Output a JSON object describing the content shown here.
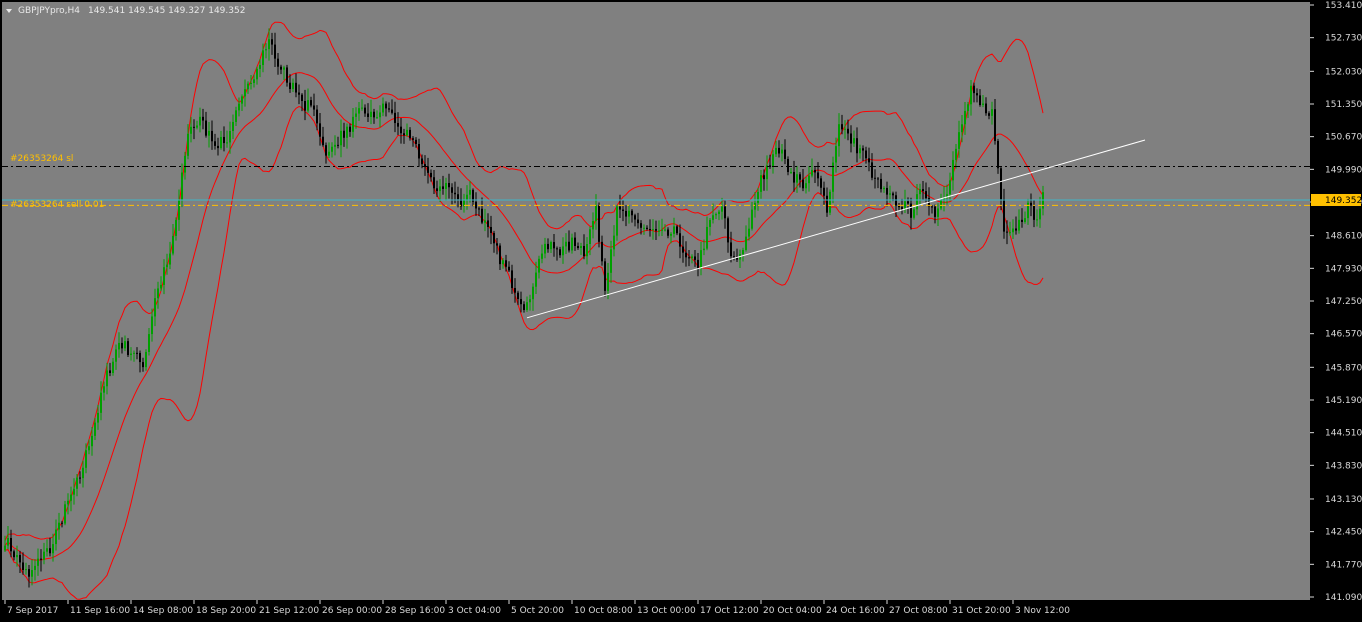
{
  "header": {
    "symbol": "GBPJPYpro,H4",
    "ohlc": "149.541 149.545 149.327 149.352"
  },
  "colors": {
    "background": "#808080",
    "frame": "#000000",
    "bull_candle": "#00a000",
    "bear_candle": "#000000",
    "bollinger": "#ff0000",
    "trendline": "#ffffff",
    "sl_line": "#000000",
    "order_line": "#ffc000",
    "bid_line": "#3fb6c8",
    "price_label_bg": "#ffc000"
  },
  "orders": {
    "sl_label": "#26353264 sl",
    "entry_label": "#26353264 sell 0.01"
  },
  "current_price_label": "149.352",
  "chart_data": {
    "type": "candlestick",
    "timeframe": "H4",
    "y_ticks": [
      "153.410",
      "152.730",
      "152.030",
      "151.350",
      "150.670",
      "149.990",
      "149.310",
      "148.610",
      "147.930",
      "147.250",
      "146.570",
      "145.870",
      "145.190",
      "144.510",
      "143.830",
      "143.130",
      "142.450",
      "141.770",
      "141.090"
    ],
    "ylim": [
      141.09,
      153.41
    ],
    "x_ticks": [
      "7 Sep 2017",
      "11 Sep 16:00",
      "14 Sep 08:00",
      "18 Sep 20:00",
      "21 Sep 12:00",
      "26 Sep 00:00",
      "28 Sep 16:00",
      "3 Oct 04:00",
      "5 Oct 20:00",
      "10 Oct 08:00",
      "13 Oct 00:00",
      "17 Oct 12:00",
      "20 Oct 04:00",
      "24 Oct 16:00",
      "27 Oct 08:00",
      "31 Oct 20:00",
      "3 Nov 12:00"
    ],
    "anchors": [
      [
        0,
        142.3
      ],
      [
        8,
        141.5
      ],
      [
        12,
        141.9
      ],
      [
        16,
        142.2
      ],
      [
        20,
        142.9
      ],
      [
        25,
        143.6
      ],
      [
        29,
        144.5
      ],
      [
        34,
        145.7
      ],
      [
        38,
        146.4
      ],
      [
        42,
        146.2
      ],
      [
        46,
        145.9
      ],
      [
        50,
        147.3
      ],
      [
        55,
        148.2
      ],
      [
        58,
        149.3
      ],
      [
        61,
        150.8
      ],
      [
        65,
        151.0
      ],
      [
        69,
        150.6
      ],
      [
        73,
        150.5
      ],
      [
        77,
        151.1
      ],
      [
        81,
        151.7
      ],
      [
        85,
        152.3
      ],
      [
        88,
        152.7
      ],
      [
        91,
        152.2
      ],
      [
        95,
        151.8
      ],
      [
        99,
        151.3
      ],
      [
        103,
        151.3
      ],
      [
        107,
        150.2
      ],
      [
        111,
        150.6
      ],
      [
        115,
        150.9
      ],
      [
        119,
        151.2
      ],
      [
        123,
        151.1
      ],
      [
        127,
        151.3
      ],
      [
        131,
        150.9
      ],
      [
        135,
        150.6
      ],
      [
        139,
        150.2
      ],
      [
        143,
        149.6
      ],
      [
        147,
        149.7
      ],
      [
        151,
        149.3
      ],
      [
        155,
        149.5
      ],
      [
        159,
        149.0
      ],
      [
        163,
        148.4
      ],
      [
        167,
        147.9
      ],
      [
        171,
        147.4
      ],
      [
        174,
        147.1
      ],
      [
        178,
        148.2
      ],
      [
        182,
        148.4
      ],
      [
        186,
        148.3
      ],
      [
        190,
        148.5
      ],
      [
        193,
        148.3
      ],
      [
        197,
        149.1
      ],
      [
        200,
        147.6
      ],
      [
        204,
        149.1
      ],
      [
        208,
        149.0
      ],
      [
        212,
        148.8
      ],
      [
        216,
        148.7
      ],
      [
        220,
        148.6
      ],
      [
        224,
        148.7
      ],
      [
        227,
        148.1
      ],
      [
        231,
        148.0
      ],
      [
        235,
        148.9
      ],
      [
        239,
        149.2
      ],
      [
        242,
        148.2
      ],
      [
        246,
        148.2
      ],
      [
        250,
        149.4
      ],
      [
        254,
        150.1
      ],
      [
        258,
        150.4
      ],
      [
        262,
        149.9
      ],
      [
        266,
        149.7
      ],
      [
        270,
        149.9
      ],
      [
        274,
        149.2
      ],
      [
        278,
        151.0
      ],
      [
        282,
        150.6
      ],
      [
        286,
        150.3
      ],
      [
        290,
        149.8
      ],
      [
        294,
        149.4
      ],
      [
        298,
        149.3
      ],
      [
        302,
        149.1
      ],
      [
        306,
        149.6
      ],
      [
        310,
        149.1
      ],
      [
        314,
        149.6
      ],
      [
        318,
        150.7
      ],
      [
        322,
        151.6
      ],
      [
        325,
        151.3
      ],
      [
        329,
        151.2
      ],
      [
        333,
        148.8
      ],
      [
        337,
        148.8
      ],
      [
        341,
        149.2
      ],
      [
        344,
        149.0
      ],
      [
        346,
        149.4
      ]
    ],
    "trendline": {
      "from": [
        174,
        146.9
      ],
      "to": [
        380,
        150.6
      ]
    },
    "sl_price": 150.05,
    "entry_price": 149.24,
    "bid_price": 149.352
  }
}
